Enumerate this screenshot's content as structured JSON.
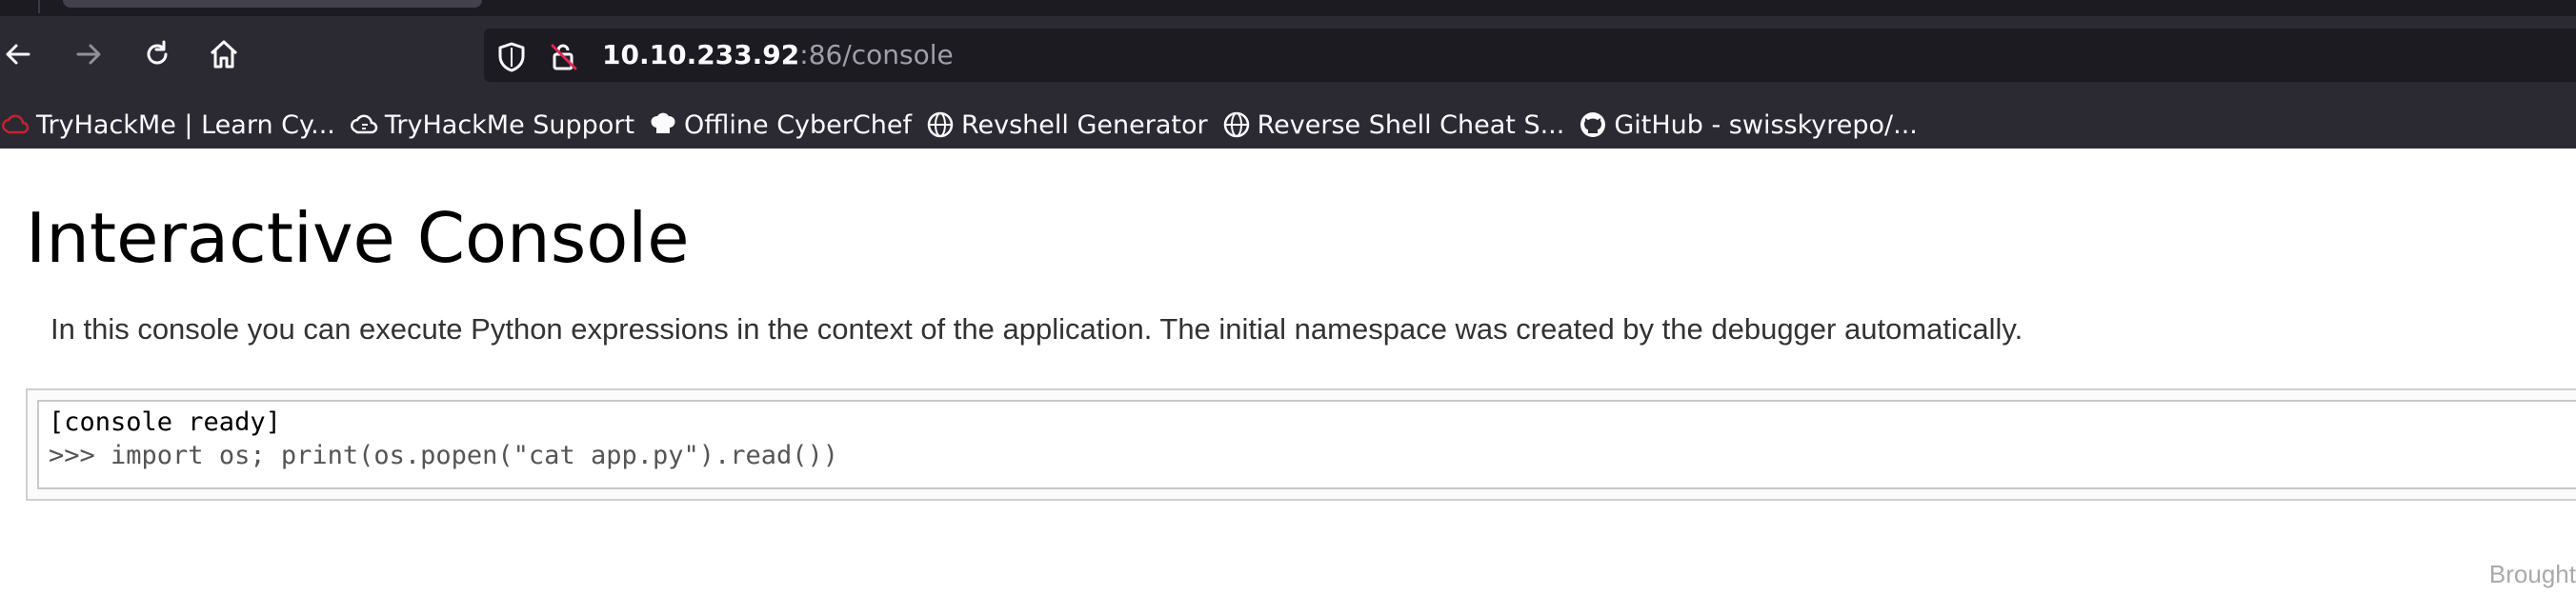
{
  "browser": {
    "url": {
      "host": "10.10.233.92",
      "path": ":86/console"
    },
    "bookmarks": [
      {
        "label": "TryHackMe | Learn Cy...",
        "icon": "tryhackme-icon"
      },
      {
        "label": "TryHackMe Support",
        "icon": "cloud-support-icon"
      },
      {
        "label": "Offline CyberChef",
        "icon": "chef-hat-icon"
      },
      {
        "label": "Revshell Generator",
        "icon": "globe-icon"
      },
      {
        "label": "Reverse Shell Cheat S...",
        "icon": "globe-icon"
      },
      {
        "label": "GitHub - swisskyrepo/...",
        "icon": "github-icon"
      }
    ],
    "colors": {
      "chrome": "#2b2a33",
      "urlbar": "#1c1b22",
      "text": "#fbfbfe"
    }
  },
  "page": {
    "title": "Interactive Console",
    "explanation": "In this console you can execute Python expressions in the context of the application. The initial namespace was created by the debugger automatically.",
    "console": {
      "status_line": "[console ready]",
      "prompt": ">>> ",
      "input_value": "import os; print(os.popen(\"cat app.py\").read())"
    },
    "footer": "Brought"
  }
}
